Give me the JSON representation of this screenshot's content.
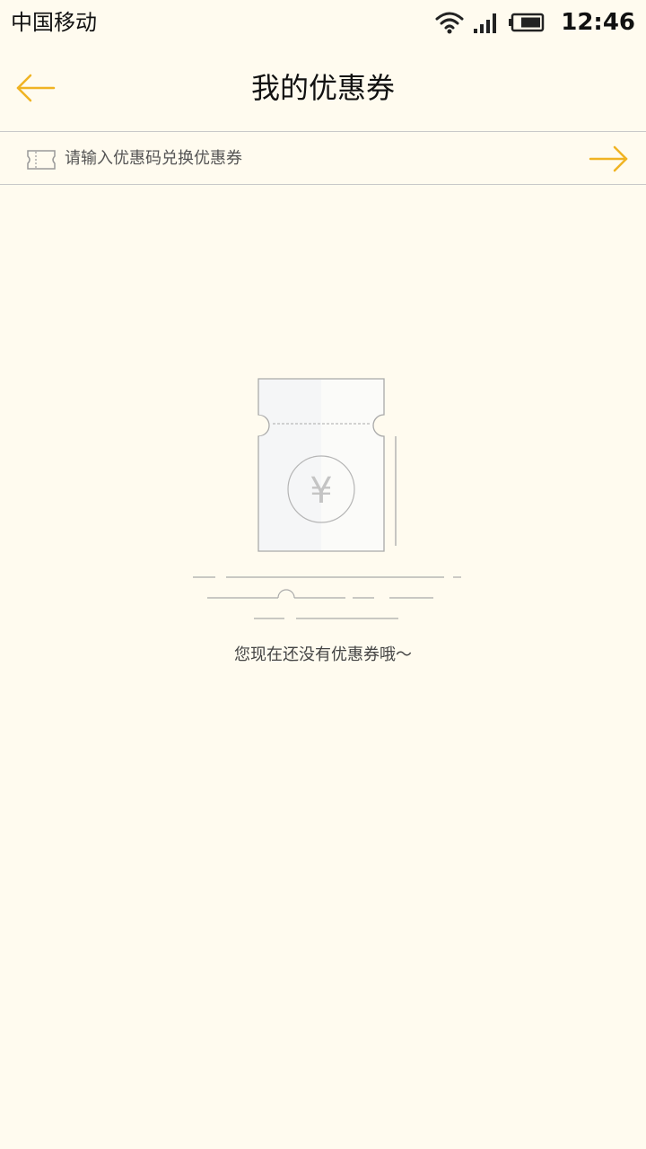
{
  "status_bar": {
    "carrier": "中国移动",
    "time": "12:46",
    "icons": [
      "wifi-icon",
      "signal-icon",
      "battery-icon"
    ]
  },
  "header": {
    "title": "我的优惠券",
    "back_icon": "arrow-left-icon"
  },
  "redeem": {
    "placeholder": "请输入优惠码兑换优惠券",
    "value": "",
    "leading_icon": "ticket-icon",
    "submit_icon": "arrow-right-icon"
  },
  "empty_state": {
    "illustration_icon": "coupon-yen-icon",
    "currency_symbol": "¥",
    "message": "您现在还没有优惠券哦～"
  },
  "colors": {
    "background": "#fffbef",
    "accent": "#f0b323",
    "divider": "#c9c9c9",
    "text_primary": "#111111",
    "text_secondary": "#444444"
  }
}
